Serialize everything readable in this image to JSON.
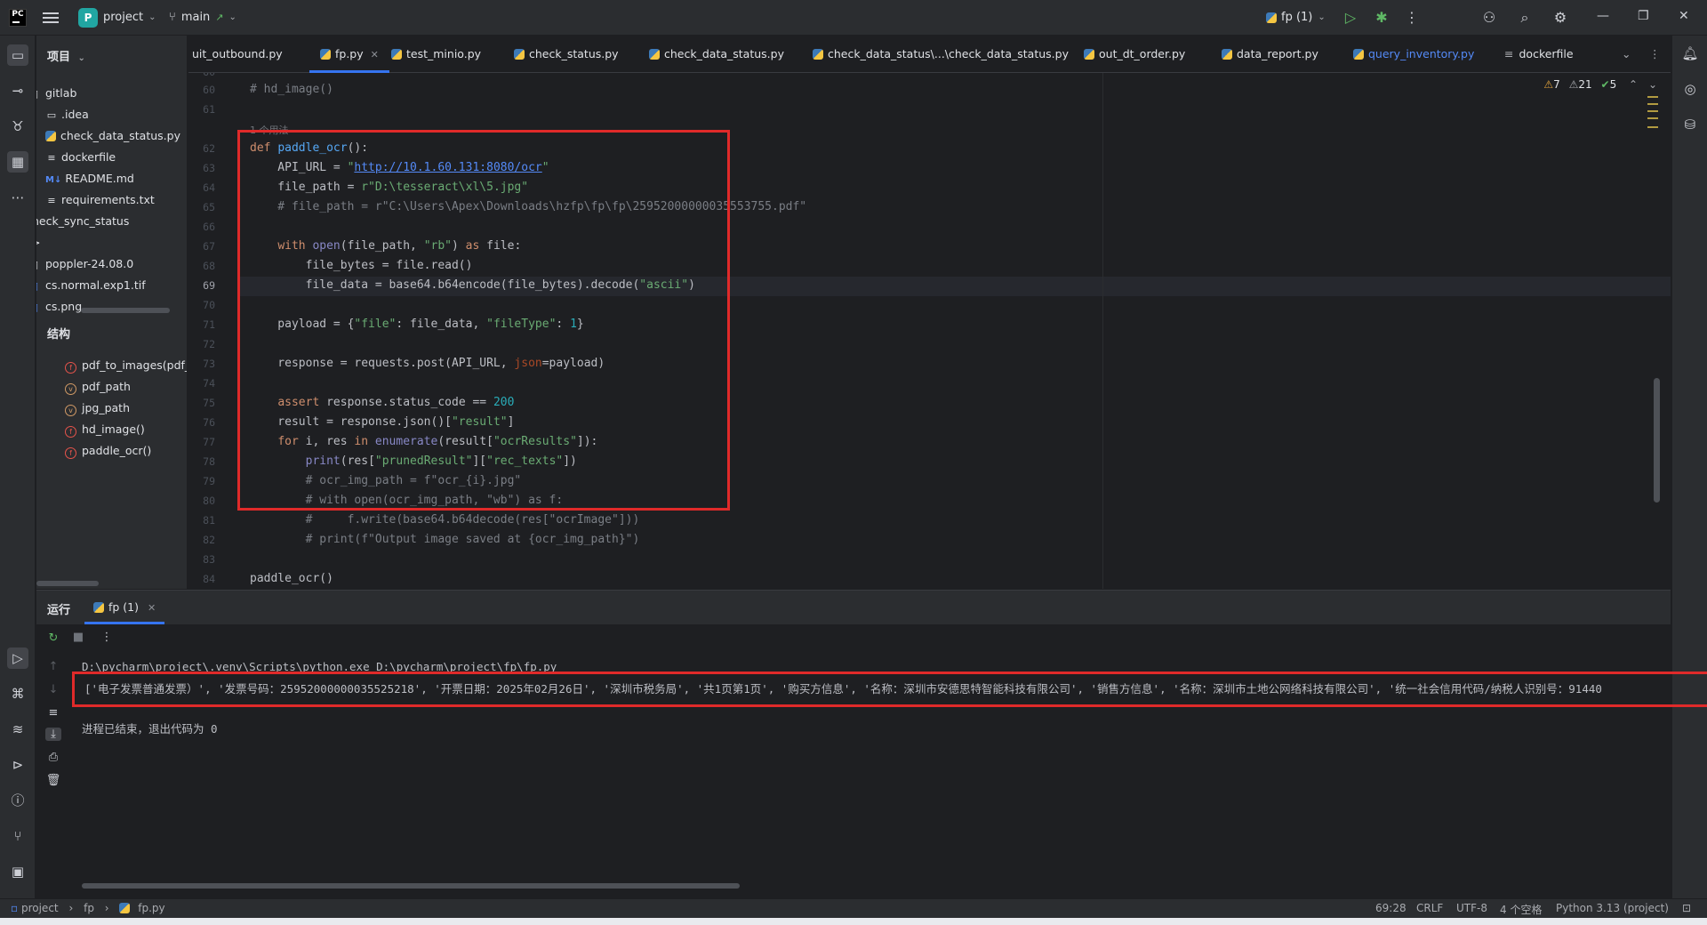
{
  "titlebar": {
    "app_logo": "PC",
    "project_badge": "P",
    "project_name": "project",
    "branch": "main",
    "run_config": "fp (1)"
  },
  "project_panel": {
    "title": "项目",
    "items": [
      {
        "label": "gitlab",
        "icon": "folder-icon"
      },
      {
        "label": ".idea",
        "icon": "folder-icon"
      },
      {
        "label": "check_data_status.py",
        "icon": "python-file-icon"
      },
      {
        "label": "dockerfile",
        "icon": "text-file-icon"
      },
      {
        "label": "README.md",
        "icon": "markdown-file-icon"
      },
      {
        "label": "requirements.txt",
        "icon": "text-file-icon"
      },
      {
        "label": "heck_sync_status",
        "icon": "folder-icon"
      },
      {
        "label": ">",
        "icon": "none"
      },
      {
        "label": "poppler-24.08.0",
        "icon": "folder-icon"
      },
      {
        "label": "cs.normal.exp1.tif",
        "icon": "image-file-icon"
      },
      {
        "label": "cs.png",
        "icon": "image-file-icon"
      }
    ],
    "structure_title": "结构",
    "structure": [
      {
        "label": "pdf_to_images(pdf_p",
        "kind": "f"
      },
      {
        "label": "pdf_path",
        "kind": "v"
      },
      {
        "label": "jpg_path",
        "kind": "v"
      },
      {
        "label": "hd_image()",
        "kind": "f"
      },
      {
        "label": "paddle_ocr()",
        "kind": "f"
      }
    ]
  },
  "tabs": [
    {
      "label": "uit_outbound.py"
    },
    {
      "label": "fp.py",
      "active": true
    },
    {
      "label": "test_minio.py"
    },
    {
      "label": "check_status.py"
    },
    {
      "label": "check_data_status.py"
    },
    {
      "label": "check_data_status\\...\\check_data_status.py"
    },
    {
      "label": "out_dt_order.py"
    },
    {
      "label": "data_report.py"
    },
    {
      "label": "query_inventory.py"
    },
    {
      "label": "dockerfile"
    }
  ],
  "editor": {
    "inspections": {
      "warnings": "7",
      "weak_warnings": "21",
      "ok": "5"
    },
    "usage_hint": "1 个用法",
    "current_line": "69",
    "lines": [
      {
        "n": "60",
        "code": "# hd_image()"
      },
      {
        "n": "61",
        "code": ""
      },
      {
        "n": "62",
        "code": "def paddle_ocr():"
      },
      {
        "n": "63",
        "code": "    API_URL = \"http://10.1.60.131:8080/ocr\""
      },
      {
        "n": "64",
        "code": "    file_path = r\"D:\\tesseract\\xl\\5.jpg\""
      },
      {
        "n": "65",
        "code": "    # file_path = r\"C:\\Users\\Apex\\Downloads\\hzfp\\fp\\fp\\25952000000035553755.pdf\""
      },
      {
        "n": "66",
        "code": ""
      },
      {
        "n": "67",
        "code": "    with open(file_path, \"rb\") as file:"
      },
      {
        "n": "68",
        "code": "        file_bytes = file.read()"
      },
      {
        "n": "69",
        "code": "        file_data = base64.b64encode(file_bytes).decode(\"ascii\")"
      },
      {
        "n": "70",
        "code": ""
      },
      {
        "n": "71",
        "code": "    payload = {\"file\": file_data, \"fileType\": 1}"
      },
      {
        "n": "72",
        "code": ""
      },
      {
        "n": "73",
        "code": "    response = requests.post(API_URL, json=payload)"
      },
      {
        "n": "74",
        "code": ""
      },
      {
        "n": "75",
        "code": "    assert response.status_code == 200"
      },
      {
        "n": "76",
        "code": "    result = response.json()[\"result\"]"
      },
      {
        "n": "77",
        "code": "    for i, res in enumerate(result[\"ocrResults\"]):"
      },
      {
        "n": "78",
        "code": "        print(res[\"prunedResult\"][\"rec_texts\"])"
      },
      {
        "n": "79",
        "code": "        # ocr_img_path = f\"ocr_{i}.jpg\""
      },
      {
        "n": "80",
        "code": "        # with open(ocr_img_path, \"wb\") as f:"
      },
      {
        "n": "81",
        "code": "        #     f.write(base64.b64decode(res[\"ocrImage\"]))"
      },
      {
        "n": "82",
        "code": "        # print(f\"Output image saved at {ocr_img_path}\")"
      },
      {
        "n": "83",
        "code": ""
      },
      {
        "n": "84",
        "code": "paddle_ocr()"
      }
    ]
  },
  "run_panel": {
    "title": "运行",
    "tab": "fp (1)",
    "command": "D:\\pycharm\\project\\.venv\\Scripts\\python.exe D:\\pycharm\\project\\fp\\fp.py",
    "output": "['电子发票普通发票）', '发票号码：25952000000035525218', '开票日期：2025年02月26日', '深圳市税务局', '共1页第1页', '购买方信息', '名称：深圳市安德思特智能科技有限公司', '销售方信息', '名称：深圳市土地公网络科技有限公司', '统一社会信用代码/纳税人识别号：91440",
    "exit": "进程已结束，退出代码为 0"
  },
  "statusbar": {
    "breadcrumb": [
      "project",
      "fp",
      "fp.py"
    ],
    "position": "69:28",
    "line_sep": "CRLF",
    "encoding": "UTF-8",
    "indent": "4 个空格",
    "interpreter": "Python 3.13 (project)"
  },
  "colors": {
    "accent": "#3574f0",
    "highlight_box": "#e02a2a"
  }
}
